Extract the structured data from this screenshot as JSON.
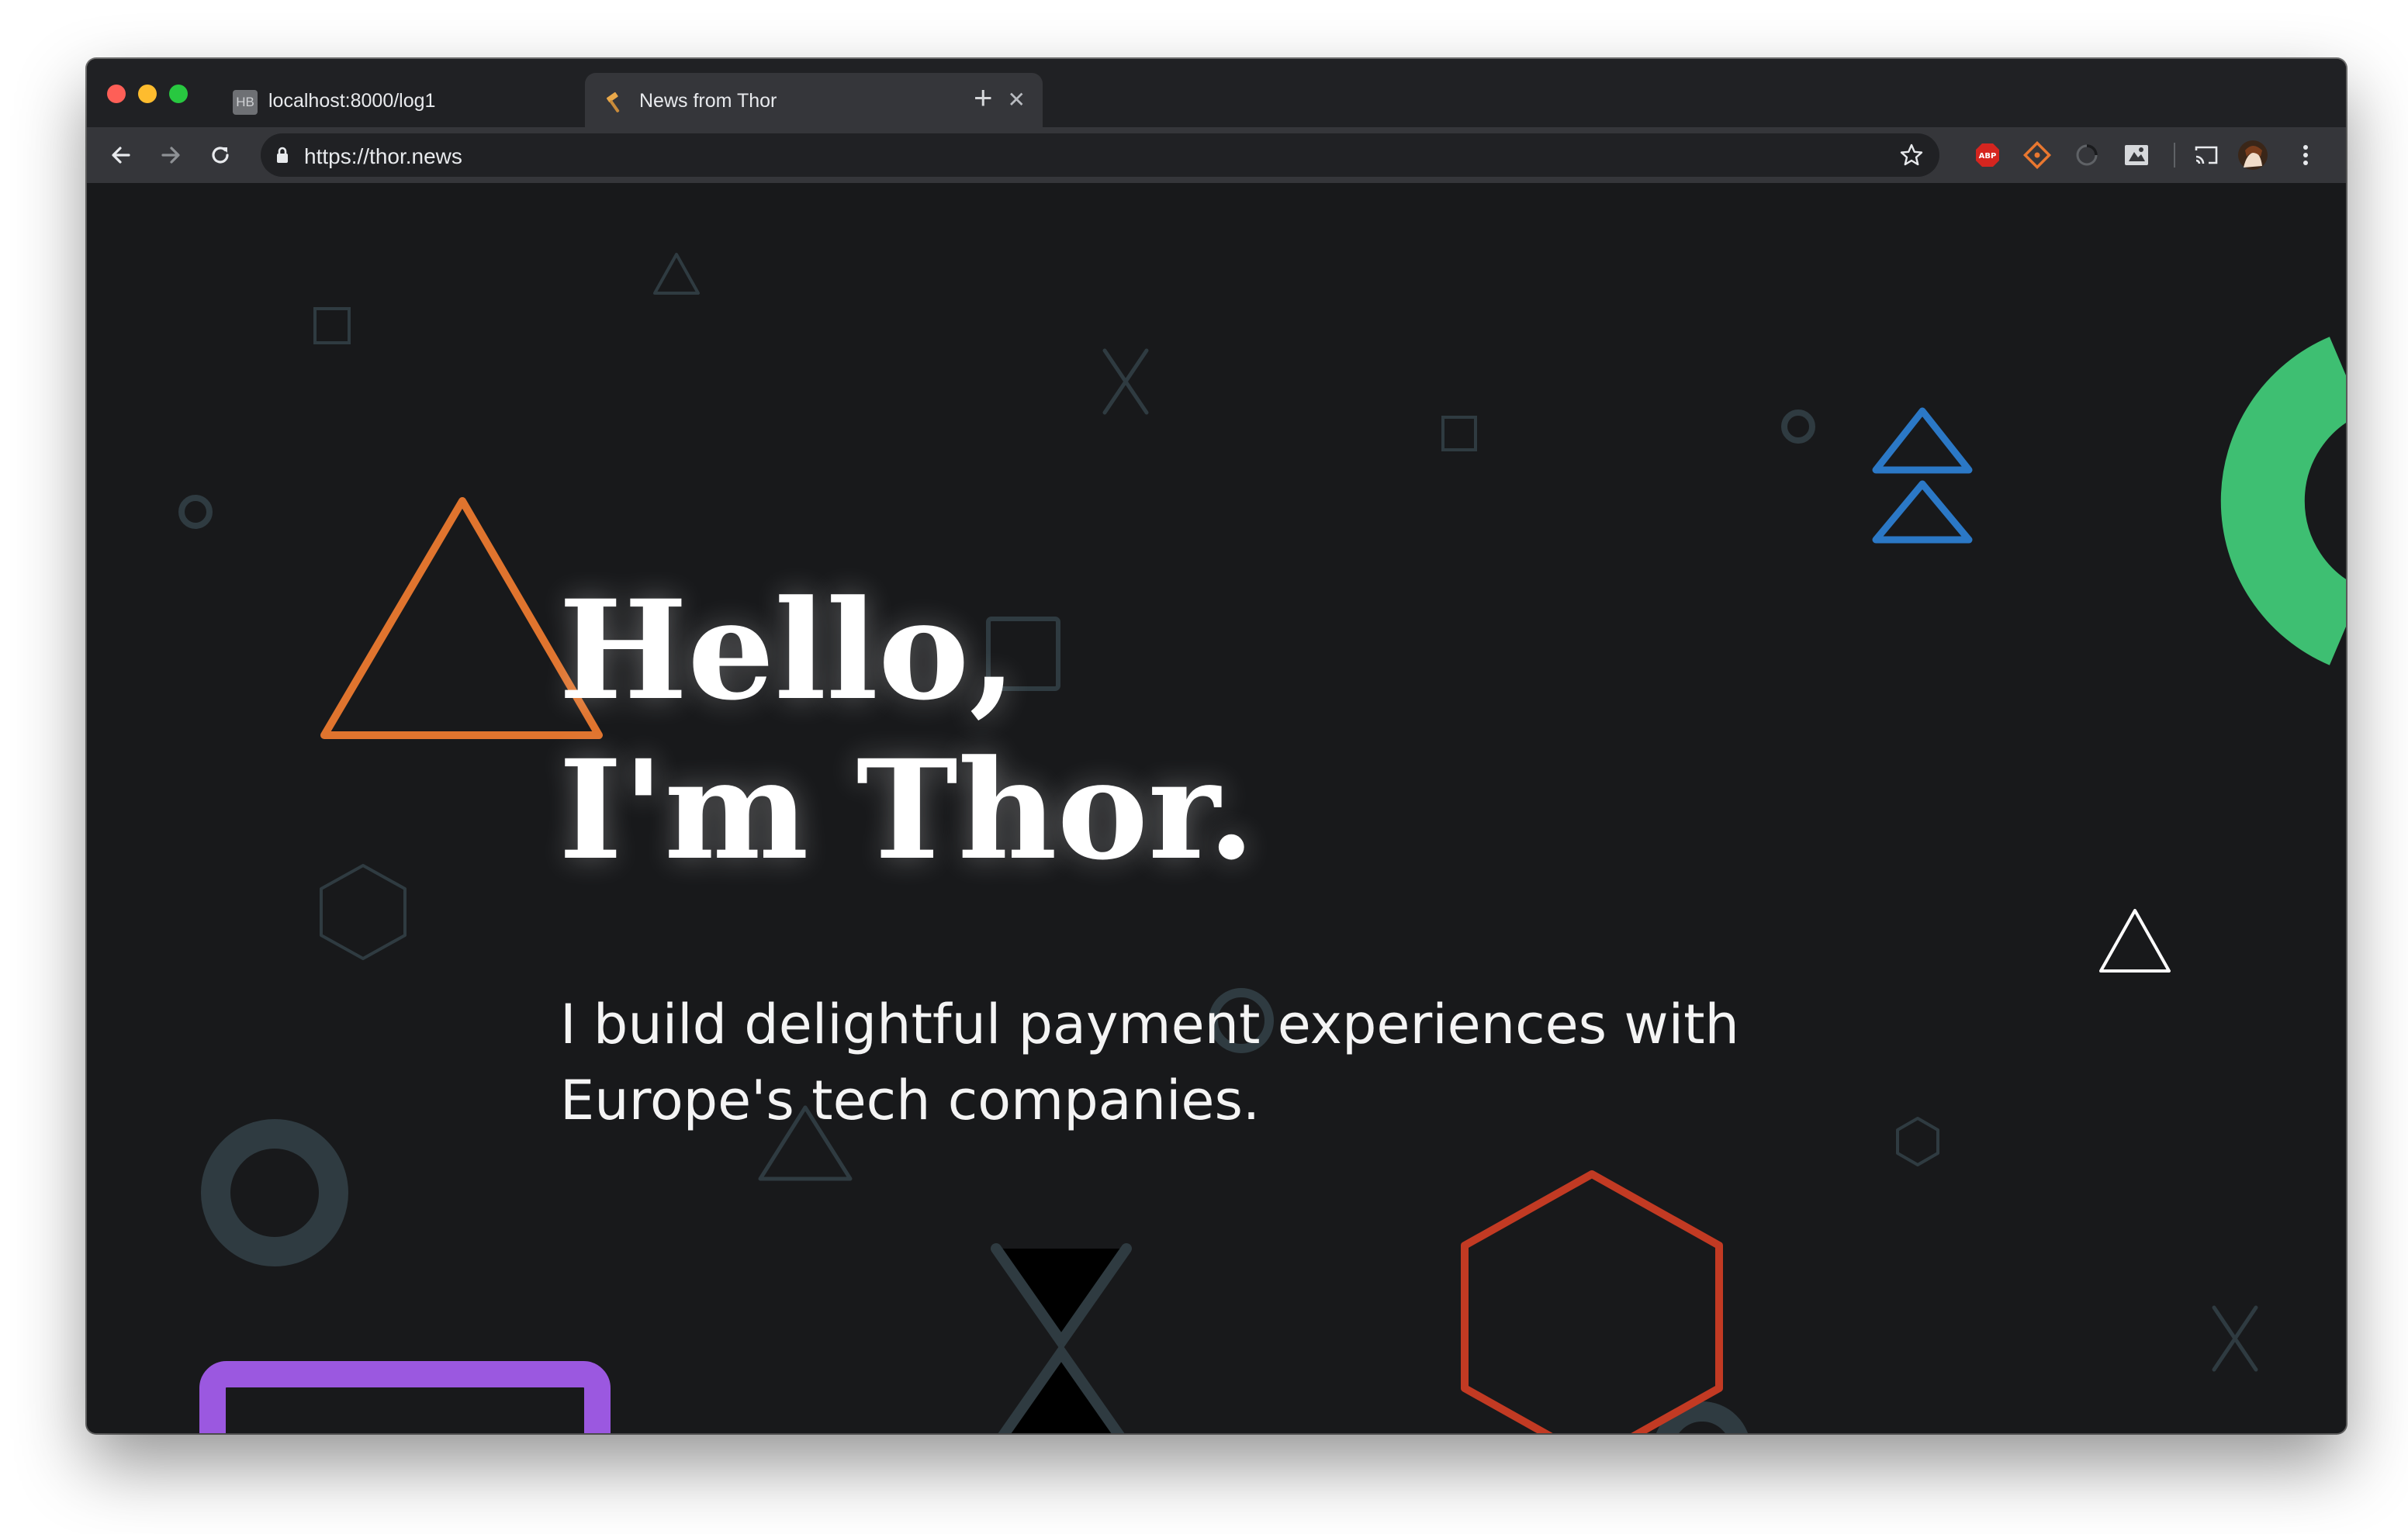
{
  "browser": {
    "tabs": [
      {
        "title": "localhost:8000/log1",
        "favicon": "hb-icon",
        "active": false
      },
      {
        "title": "News from Thor",
        "favicon": "hammer-icon",
        "active": true
      }
    ],
    "hb_favicon_text": "HB",
    "url": "https://thor.news",
    "extensions": [
      "adblock-plus-icon",
      "git-extension-icon",
      "loading-spinner-icon",
      "screen-capture-icon"
    ],
    "abp_label": "ABP"
  },
  "hero": {
    "title_line1": "Hello,",
    "title_line2": "I'm Thor.",
    "subtitle_line1": "I build delightful payment experiences with",
    "subtitle_line2": "Europe's tech companies."
  },
  "colors": {
    "background": "#18191b",
    "shape_muted": "#2f3b41",
    "orange": "#e0742e",
    "blue": "#2b78c6",
    "green": "#3ebf72",
    "purple": "#9b58e0",
    "red": "#c23a23",
    "white": "#ffffff"
  }
}
